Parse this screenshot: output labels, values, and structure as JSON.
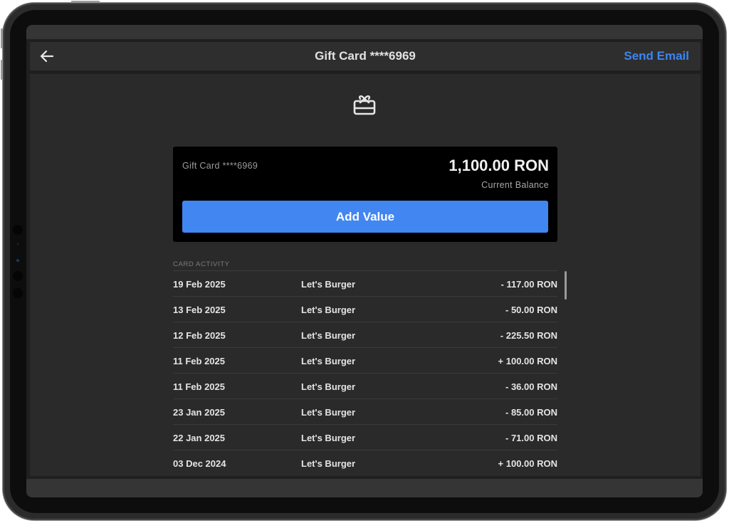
{
  "navbar": {
    "back_icon": "arrow-left-icon",
    "title": "Gift Card ****6969",
    "send_email": "Send Email"
  },
  "hero": {
    "icon": "gift-card-icon"
  },
  "card": {
    "name": "Gift Card ****6969",
    "balance": "1,100.00 RON",
    "balance_label": "Current Balance",
    "add_value": "Add Value"
  },
  "activity": {
    "label": "CARD ACTIVITY",
    "rows": [
      {
        "date": "19 Feb 2025",
        "merchant": "Let's Burger",
        "amount": "- 117.00 RON"
      },
      {
        "date": "13 Feb 2025",
        "merchant": "Let's Burger",
        "amount": "- 50.00 RON"
      },
      {
        "date": "12 Feb 2025",
        "merchant": "Let's Burger",
        "amount": "- 225.50 RON"
      },
      {
        "date": "11 Feb 2025",
        "merchant": "Let's Burger",
        "amount": "+ 100.00 RON"
      },
      {
        "date": "11 Feb 2025",
        "merchant": "Let's Burger",
        "amount": "- 36.00 RON"
      },
      {
        "date": "23 Jan 2025",
        "merchant": "Let's Burger",
        "amount": "- 85.00 RON"
      },
      {
        "date": "22 Jan 2025",
        "merchant": "Let's Burger",
        "amount": "- 71.00 RON"
      },
      {
        "date": "03 Dec 2024",
        "merchant": "Let's Burger",
        "amount": "+ 100.00 RON"
      }
    ]
  },
  "colors": {
    "accent": "#4286f1",
    "link": "#3d85f0",
    "background": "#2a2a2a",
    "card_background": "#000000"
  }
}
